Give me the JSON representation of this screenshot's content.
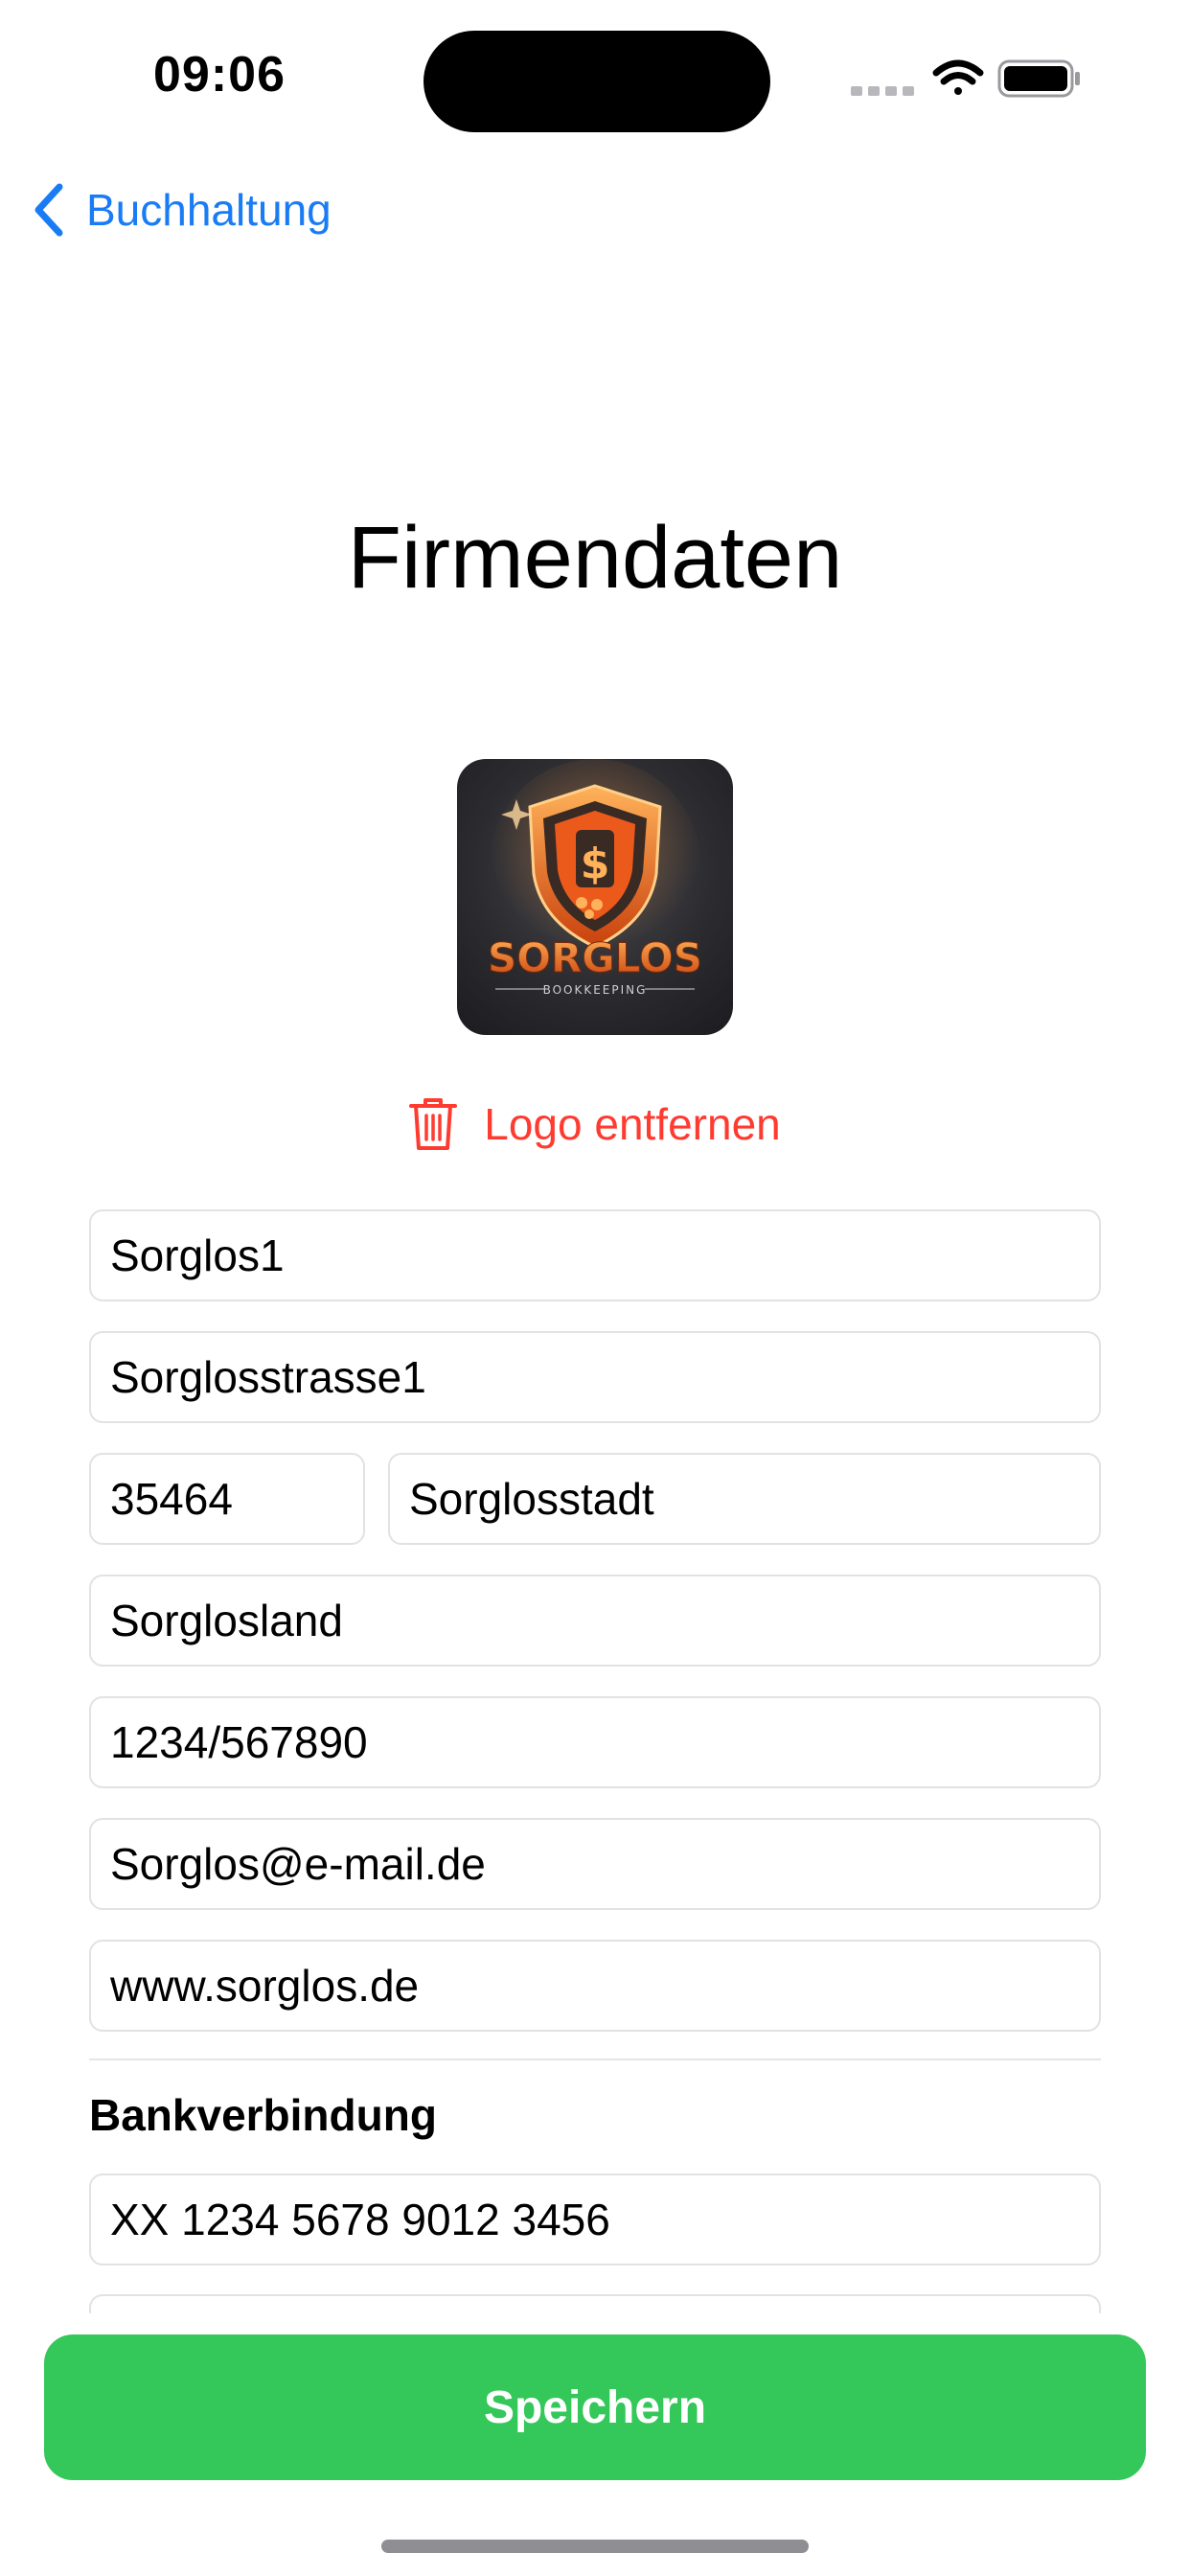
{
  "status_bar": {
    "time": "09:06"
  },
  "nav": {
    "back_label": "Buchhaltung"
  },
  "page": {
    "title": "Firmendaten"
  },
  "logo": {
    "brand_text": "SORGLOS",
    "tagline": "BOOKKEEPING"
  },
  "actions": {
    "remove_logo": "Logo entfernen",
    "save": "Speichern"
  },
  "form": {
    "company_name": "Sorglos1",
    "street": "Sorglosstrasse1",
    "zip": "35464",
    "city": "Sorglosstadt",
    "country": "Sorglosland",
    "tax_number": "1234/567890",
    "email": "Sorglos@e-mail.de",
    "website": "www.sorglos.de"
  },
  "bank": {
    "section_title": "Bankverbindung",
    "iban": "XX 1234 5678 9012 3456"
  },
  "colors": {
    "accent_blue": "#1a7cf5",
    "destructive_red": "#ff3b30",
    "save_green": "#34c759"
  }
}
